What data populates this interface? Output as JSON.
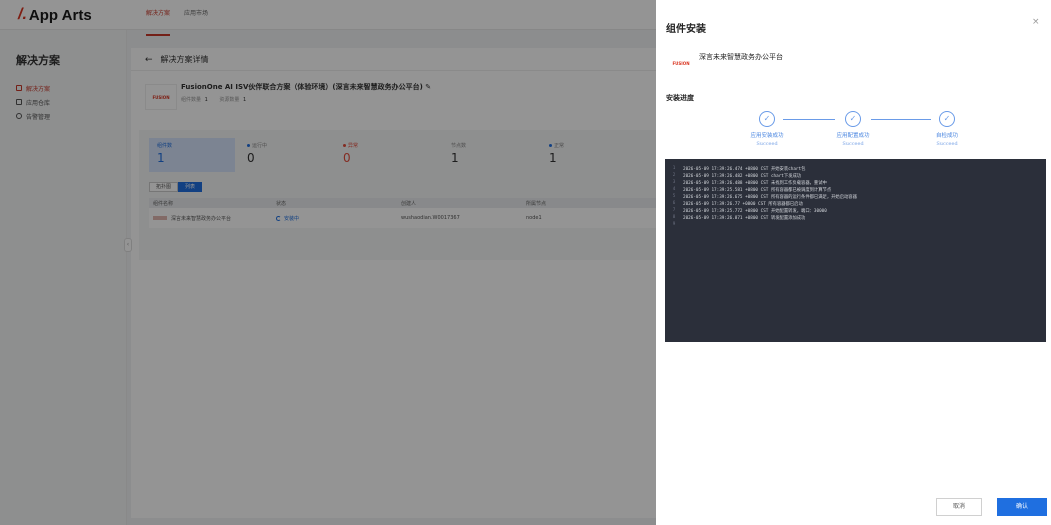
{
  "app": {
    "logo_mark": "/.",
    "logo_text": "App Arts"
  },
  "topnav": {
    "items": [
      "解决方案",
      "应用市场"
    ]
  },
  "sidebar": {
    "title": "解决方案",
    "items": [
      "解决方案",
      "应用仓库",
      "告警管理"
    ],
    "collapse_glyph": "‹"
  },
  "main": {
    "back_glyph": "←",
    "title": "解决方案详情",
    "solution": {
      "logo": "FUSION",
      "title": "FusionOne AI ISV伙伴联合方案（体验环境）(深言未来智慧政务办公平台) ✎",
      "meta_app_label": "组件数量",
      "meta_app_value": "1",
      "meta_res_label": "资源数量",
      "meta_res_value": "1"
    },
    "stats": [
      {
        "label": "组件数",
        "value": "1"
      },
      {
        "label": "运行中",
        "value": "0"
      },
      {
        "label": "异常",
        "value": "0"
      },
      {
        "label": "节点数",
        "value": "1"
      },
      {
        "label": "正常",
        "value": "1"
      }
    ],
    "view_toggle": [
      "拓扑图",
      "列表"
    ],
    "table": {
      "headers": [
        "组件名称",
        "状态",
        "创建人",
        "所属节点"
      ],
      "rows": [
        {
          "name": "深言未来智慧政务办公平台",
          "status": "安装中",
          "creator": "wushaodian.W0017367",
          "node": "node1"
        }
      ]
    }
  },
  "drawer": {
    "title": "组件安装",
    "close": "×",
    "app_logo": "FUSION",
    "app_name": "深言未来智慧政务办公平台",
    "progress_title": "安装进度",
    "steps": [
      {
        "label": "应用安装成功",
        "sub": "Succeed"
      },
      {
        "label": "应用配置成功",
        "sub": "Succeed"
      },
      {
        "label": "自检成功",
        "sub": "Succeed"
      }
    ],
    "log_lines": [
      "2026-05-09 17:39:26.474 +0800 CST 开始安装chart包",
      "2026-05-09 17:39:26.482 +0800 CST chart下发成功",
      "2026-05-09 17:39:26.488 +0800 CST 未找到工作负载容器，重试中",
      "2026-05-09 17:39:25.581 +0800 CST 所有容器都已被调度到计算节点",
      "2026-05-09 17:39:26.675 +0800 CST 所有容器的运行条件都已满足，开始启动容器",
      "2026-05-09 17:39:26.77 +0800 CST 所有容器都已启动",
      "2026-05-09 17:39:25.772 +0800 CST 开始配置转发，端口：30000",
      "2026-05-09 17:39:26.871 +0800 CST 转发配置添加成功",
      ""
    ],
    "cancel": "取消",
    "confirm": "确认"
  },
  "colors": {
    "accent": "#1f6fe0",
    "brand": "#c8382a",
    "log_bg": "#2b2f3a"
  }
}
